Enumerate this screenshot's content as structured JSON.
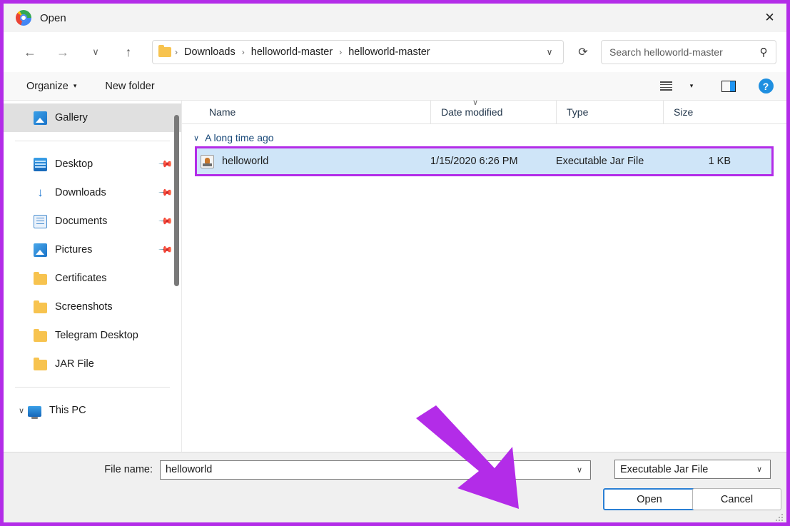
{
  "window": {
    "title": "Open",
    "app_icon": "chrome-icon",
    "close_label": "✕"
  },
  "nav": {
    "back": "←",
    "forward": "→",
    "recent": "∨",
    "up": "↑",
    "refresh": "⟳",
    "breadcrumb_chevron": "∨",
    "breadcrumb": [
      "Downloads",
      "helloworld-master",
      "helloworld-master"
    ],
    "separator": "›"
  },
  "search": {
    "placeholder": "Search helloworld-master",
    "value": "",
    "icon": "search-icon"
  },
  "command_bar": {
    "organize": "Organize",
    "organize_caret": "▾",
    "new_folder": "New folder",
    "view_icon": "list-view-icon",
    "view_caret": "▾",
    "preview_pane_icon": "preview-pane-icon",
    "help_icon": "help-icon",
    "help_glyph": "?"
  },
  "sidebar": {
    "items": [
      {
        "label": "Gallery",
        "icon": "gallery-icon",
        "selected": true,
        "pinned": false
      },
      {
        "label": "Desktop",
        "icon": "desktop-icon",
        "selected": false,
        "pinned": true
      },
      {
        "label": "Downloads",
        "icon": "download-icon",
        "selected": false,
        "pinned": true
      },
      {
        "label": "Documents",
        "icon": "documents-icon",
        "selected": false,
        "pinned": true
      },
      {
        "label": "Pictures",
        "icon": "pictures-icon",
        "selected": false,
        "pinned": true
      },
      {
        "label": "Certificates",
        "icon": "folder-icon",
        "selected": false,
        "pinned": false
      },
      {
        "label": "Screenshots",
        "icon": "folder-icon",
        "selected": false,
        "pinned": false
      },
      {
        "label": "Telegram Desktop",
        "icon": "folder-icon",
        "selected": false,
        "pinned": false
      },
      {
        "label": "JAR File",
        "icon": "folder-icon",
        "selected": false,
        "pinned": false
      }
    ],
    "root": {
      "label": "This PC",
      "icon": "pc-icon",
      "chevron": "∨"
    },
    "pin_glyph": "📌"
  },
  "file_list": {
    "columns": [
      {
        "key": "name",
        "label": "Name"
      },
      {
        "key": "date",
        "label": "Date modified"
      },
      {
        "key": "type",
        "label": "Type"
      },
      {
        "key": "size",
        "label": "Size"
      }
    ],
    "sort_indicator": "∨",
    "group": {
      "label": "A long time ago",
      "chevron": "∨"
    },
    "rows": [
      {
        "name": "helloworld",
        "date": "1/15/2020 6:26 PM",
        "type": "Executable Jar File",
        "size": "1 KB",
        "icon": "jar-file-icon",
        "selected": true,
        "annotated": true
      }
    ]
  },
  "footer": {
    "filename_label": "File name:",
    "filename_value": "helloworld",
    "filename_caret": "∨",
    "filetype_value": "Executable Jar File",
    "filetype_caret": "∨",
    "open_label": "Open",
    "cancel_label": "Cancel"
  },
  "annotations": {
    "highlight_color": "#b32ce8",
    "arrow_color": "#b32ce8",
    "selection_color": "#cfe5f8",
    "focus_color": "#2a7fd4"
  }
}
